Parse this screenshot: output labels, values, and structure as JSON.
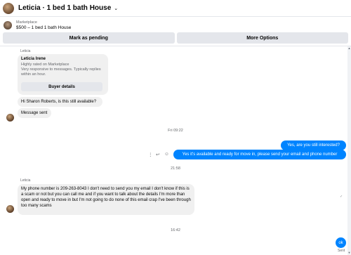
{
  "header": {
    "title": "Leticia · 1 bed 1 bath House",
    "chevron": "⌄"
  },
  "listing": {
    "category": "Marketplace",
    "name": "$500 – 1 bed 1 bath House"
  },
  "actions": {
    "pending_label": "Mark as pending",
    "more_label": "More Options"
  },
  "chat": {
    "sender1": "Leticia",
    "profile_card": {
      "name": "Leticia Irene",
      "subtitle": "Highly rated on Marketplace\nVery responsive to messages. Typically replies within an hour.",
      "button_label": "Buyer details"
    },
    "msg1": "Hi Sharon Roberts, is this still available?",
    "msg2": "Message sent",
    "time1": "Fri 09:22",
    "out1": "Yes, are you still interested?",
    "out2": "Yes it's available and ready for move in, please send your email and phone number",
    "time2": "21:58",
    "sender2": "Leticia",
    "msg3": "My phone number is 209-263-8043 I don't need to send you my email I don't know if this is a scam or not but you can call me and if you want to talk about the details I'm more than open and ready to move in but I'm not going to do none of this email crap I've been through too many scams",
    "time3": "16:42",
    "out3": "ok",
    "sent_label": "Sent"
  },
  "icons": {
    "more": "⋮",
    "reply": "↩",
    "react": "☺",
    "scroll_up": "▲",
    "scroll_down": "▼",
    "read_receipt": "✓"
  },
  "colors": {
    "outgoing_bubble": "#0084ff",
    "incoming_bubble": "#f0f0f0"
  }
}
